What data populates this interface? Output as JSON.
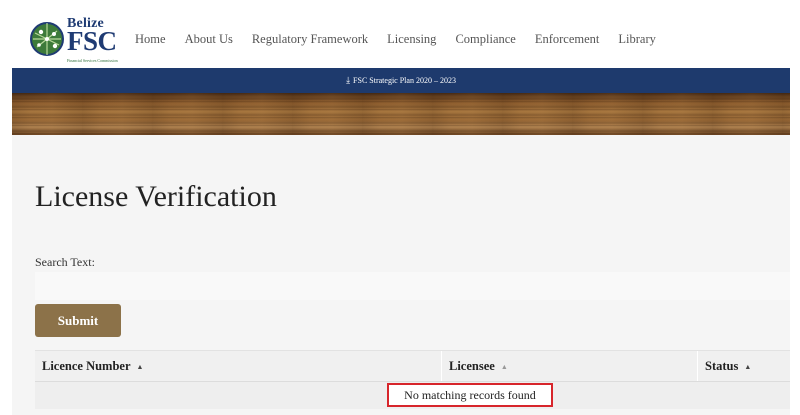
{
  "header": {
    "logo": {
      "top_text": "Belize",
      "main_text": "FSC",
      "tagline": "Financial Services Commission"
    },
    "nav": [
      "Home",
      "About Us",
      "Regulatory Framework",
      "Licensing",
      "Compliance",
      "Enforcement",
      "Library"
    ]
  },
  "banner": {
    "download_label": "FSC Strategic Plan 2020 – 2023",
    "icon": "download-icon"
  },
  "page": {
    "title": "License Verification",
    "search_label": "Search Text:",
    "search_value": "",
    "submit_label": "Submit"
  },
  "table": {
    "columns": [
      "Licence Number",
      "Licensee",
      "Status"
    ],
    "empty_message": "No matching records found"
  },
  "colors": {
    "brand_blue": "#1e3a6d",
    "button_brown": "#8c7249",
    "highlight_red": "#d7252b"
  }
}
